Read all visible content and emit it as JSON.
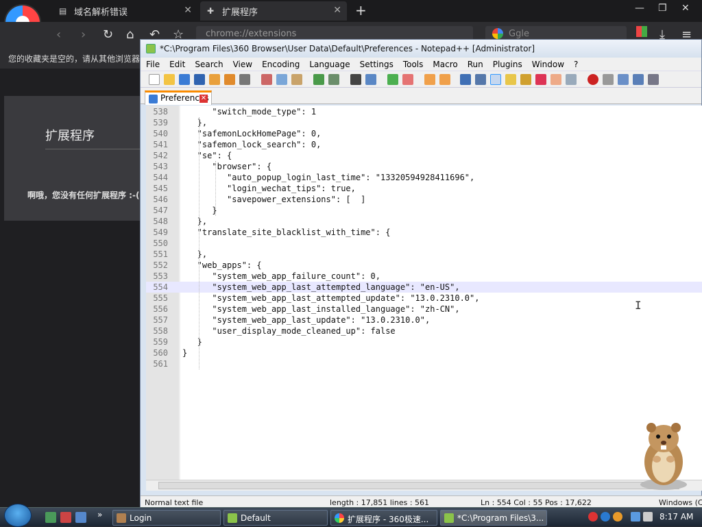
{
  "browser": {
    "tabs": [
      {
        "label": "域名解析错误"
      },
      {
        "label": "扩展程序"
      }
    ],
    "address": "chrome://extensions",
    "search_placeholder": "Ggle",
    "favorites_bar_text": "您的收藏夹是空的，请从其他浏览器",
    "extensions_page": {
      "title": "扩展程序",
      "empty_message": "啊哦，您没有任何扩展程序 :-("
    }
  },
  "npp": {
    "title": "*C:\\Program Files\\360 Browser\\User Data\\Default\\Preferences - Notepad++ [Administrator]",
    "menu": [
      "File",
      "Edit",
      "Search",
      "View",
      "Encoding",
      "Language",
      "Settings",
      "Tools",
      "Macro",
      "Run",
      "Plugins",
      "Window",
      "?"
    ],
    "doc_tab": "Preferences",
    "lines": [
      {
        "n": "538",
        "code": "      \"switch_mode_type\": 1"
      },
      {
        "n": "539",
        "code": "   },"
      },
      {
        "n": "540",
        "code": "   \"safemonLockHomePage\": 0,"
      },
      {
        "n": "541",
        "code": "   \"safemon_lock_search\": 0,"
      },
      {
        "n": "542",
        "code": "   \"se\": {"
      },
      {
        "n": "543",
        "code": "      \"browser\": {"
      },
      {
        "n": "544",
        "code": "         \"auto_popup_login_last_time\": \"13320594928411696\","
      },
      {
        "n": "545",
        "code": "         \"login_wechat_tips\": true,"
      },
      {
        "n": "546",
        "code": "         \"savepower_extensions\": [  ]"
      },
      {
        "n": "547",
        "code": "      }"
      },
      {
        "n": "548",
        "code": "   },"
      },
      {
        "n": "549",
        "code": "   \"translate_site_blacklist_with_time\": {"
      },
      {
        "n": "550",
        "code": ""
      },
      {
        "n": "551",
        "code": "   },"
      },
      {
        "n": "552",
        "code": "   \"web_apps\": {"
      },
      {
        "n": "553",
        "code": "      \"system_web_app_failure_count\": 0,"
      },
      {
        "n": "554",
        "code": "      \"system_web_app_last_attempted_language\": \"en-US\","
      },
      {
        "n": "555",
        "code": "      \"system_web_app_last_attempted_update\": \"13.0.2310.0\","
      },
      {
        "n": "556",
        "code": "      \"system_web_app_last_installed_language\": \"zh-CN\","
      },
      {
        "n": "557",
        "code": "      \"system_web_app_last_update\": \"13.0.2310.0\","
      },
      {
        "n": "558",
        "code": "      \"user_display_mode_cleaned_up\": false"
      },
      {
        "n": "559",
        "code": "   }"
      },
      {
        "n": "560",
        "code": "}"
      },
      {
        "n": "561",
        "code": ""
      }
    ],
    "current_line": "554",
    "status": {
      "type": "Normal text file",
      "length": "length : 17,851    lines : 561",
      "position": "Ln : 554    Col : 55    Pos : 17,622",
      "eol": "Windows (C"
    }
  },
  "taskbar": {
    "tasks": [
      {
        "label": "Login"
      },
      {
        "label": "Default"
      },
      {
        "label": "扩展程序 - 360极速..."
      },
      {
        "label": "*C:\\Program Files\\3..."
      }
    ],
    "clock": "8:17 AM"
  },
  "colors": {
    "tab_accent": "#fa8b00",
    "current_line_bg": "#e8e8ff"
  }
}
